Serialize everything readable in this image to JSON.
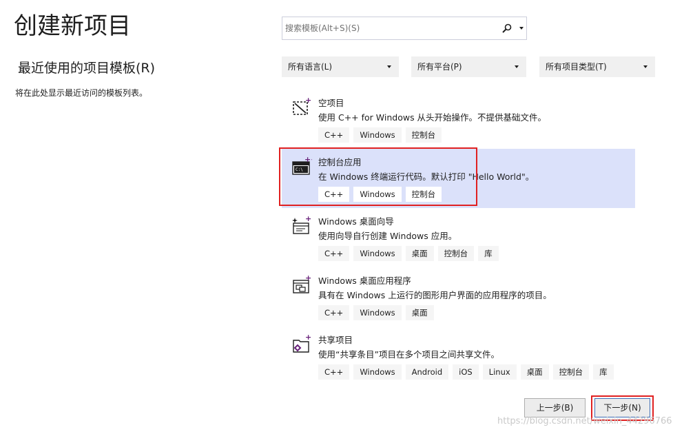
{
  "header": {
    "title": "创建新项目"
  },
  "recent": {
    "title": "最近使用的项目模板(R)",
    "empty_text": "将在此处显示最近访问的模板列表。"
  },
  "search": {
    "placeholder": "搜索模板(Alt+S)(S)",
    "value": "",
    "icon": "search-icon"
  },
  "filters": [
    {
      "label": "所有语言(L)"
    },
    {
      "label": "所有平台(P)"
    },
    {
      "label": "所有项目类型(T)"
    }
  ],
  "templates": [
    {
      "name": "空项目",
      "description": "使用 C++ for Windows 从头开始操作。不提供基础文件。",
      "tags": [
        "C++",
        "Windows",
        "控制台"
      ],
      "icon": "empty-project-icon",
      "selected": false
    },
    {
      "name": "控制台应用",
      "description": "在 Windows 终端运行代码。默认打印 \"Hello World\"。",
      "tags": [
        "C++",
        "Windows",
        "控制台"
      ],
      "icon": "console-app-icon",
      "selected": true
    },
    {
      "name": "Windows 桌面向导",
      "description": "使用向导自行创建 Windows 应用。",
      "tags": [
        "C++",
        "Windows",
        "桌面",
        "控制台",
        "库"
      ],
      "icon": "desktop-wizard-icon",
      "selected": false
    },
    {
      "name": "Windows 桌面应用程序",
      "description": "具有在 Windows 上运行的图形用户界面的应用程序的项目。",
      "tags": [
        "C++",
        "Windows",
        "桌面"
      ],
      "icon": "desktop-app-icon",
      "selected": false
    },
    {
      "name": "共享项目",
      "description": "使用“共享条目”项目在多个项目之间共享文件。",
      "tags": [
        "C++",
        "Windows",
        "Android",
        "iOS",
        "Linux",
        "桌面",
        "控制台",
        "库"
      ],
      "icon": "shared-project-icon",
      "selected": false
    }
  ],
  "buttons": {
    "back": "上一步(B)",
    "next": "下一步(N)"
  },
  "watermark": "https://blog.csdn.net/weixin_44296766",
  "colors": {
    "selected_bg": "#dbe1fa",
    "highlight": "#e02020",
    "accent": "#68217a",
    "tag_bg": "#f5f5f5"
  }
}
